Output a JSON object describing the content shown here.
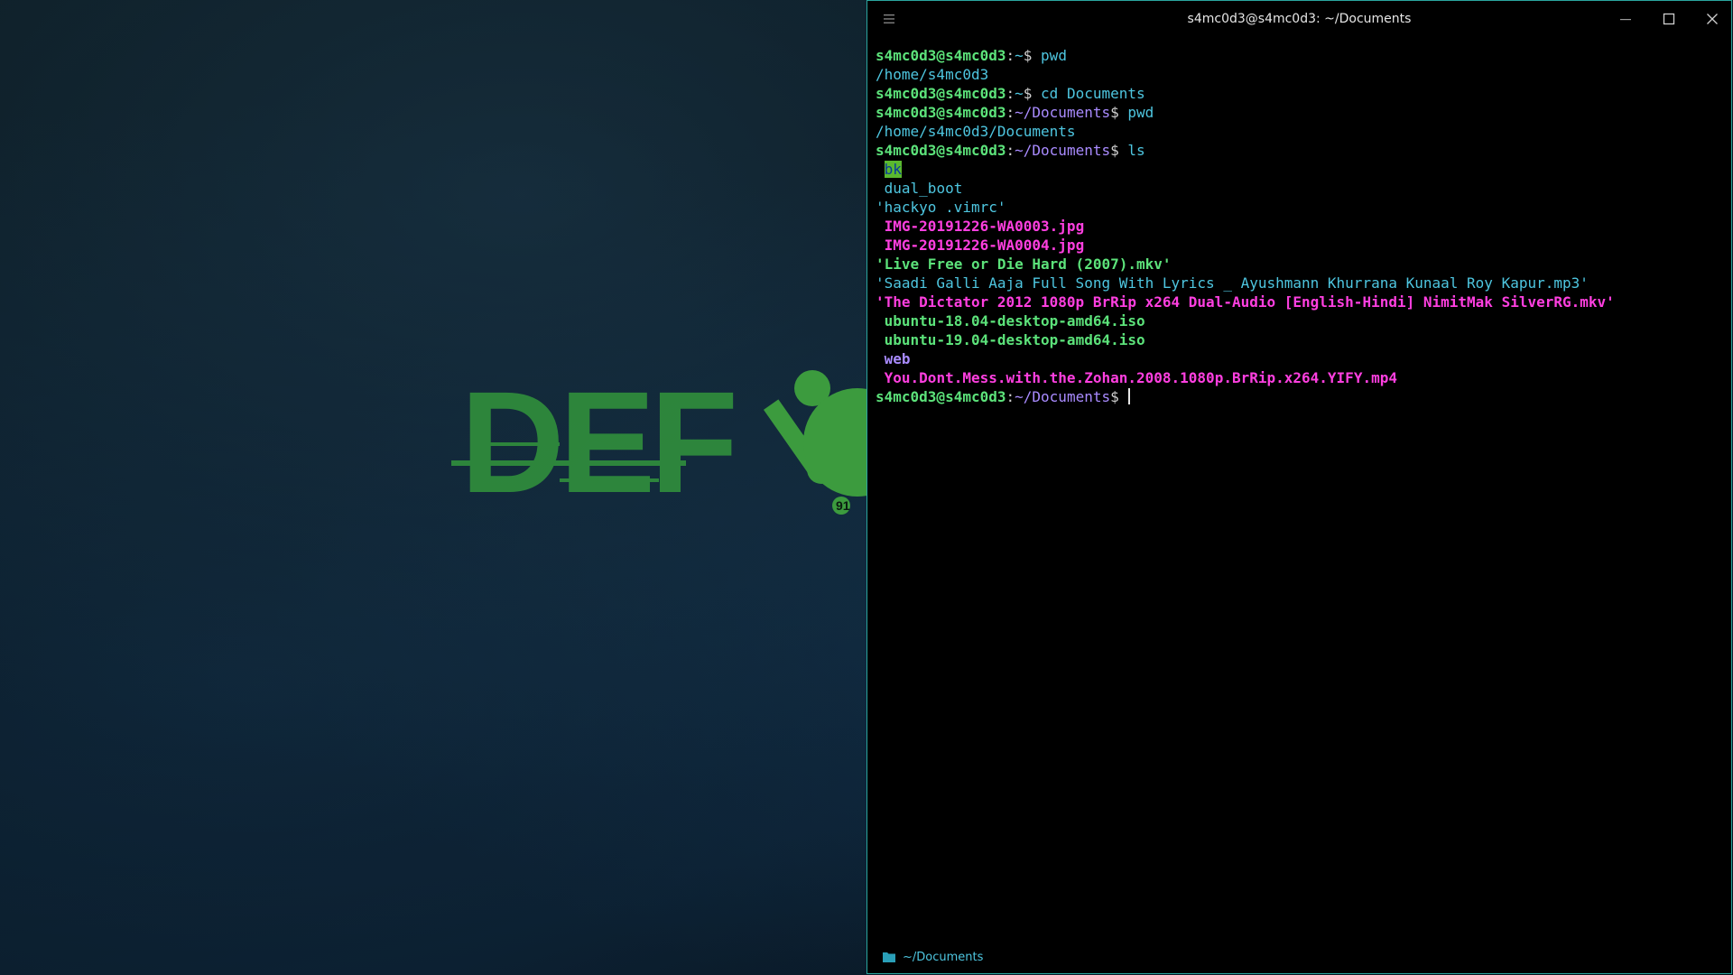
{
  "window": {
    "title": "s4mc0d3@s4mc0d3: ~/Documents"
  },
  "wallpaper": {
    "logo_text": "DEF",
    "badge_text": "91"
  },
  "terminal": {
    "lines": [
      {
        "type": "prompt",
        "user": "s4mc0d3@s4mc0d3",
        "colon": ":",
        "path": "~",
        "dollar": "$ ",
        "command": "pwd"
      },
      {
        "type": "output",
        "text": "/home/s4mc0d3",
        "class": "out"
      },
      {
        "type": "prompt",
        "user": "s4mc0d3@s4mc0d3",
        "colon": ":",
        "path": "~",
        "dollar": "$ ",
        "command": "cd Documents"
      },
      {
        "type": "prompt",
        "user": "s4mc0d3@s4mc0d3",
        "colon": ":",
        "path": "~/Documents",
        "dollar": "$ ",
        "command": "pwd"
      },
      {
        "type": "output",
        "text": "/home/s4mc0d3/Documents",
        "class": "out"
      },
      {
        "type": "prompt",
        "user": "s4mc0d3@s4mc0d3",
        "colon": ":",
        "path": "~/Documents",
        "dollar": "$ ",
        "command": "ls"
      },
      {
        "type": "file",
        "prefix": " ",
        "text": "bk",
        "class": "f-dir-hl"
      },
      {
        "type": "file",
        "prefix": " ",
        "text": "dual_boot",
        "class": "f-dir"
      },
      {
        "type": "file",
        "prefix": "",
        "text": "'hackyo .vimrc'",
        "class": "out"
      },
      {
        "type": "file",
        "prefix": " ",
        "text": "IMG-20191226-WA0003.jpg",
        "class": "f-img"
      },
      {
        "type": "file",
        "prefix": " ",
        "text": "IMG-20191226-WA0004.jpg",
        "class": "f-img"
      },
      {
        "type": "file",
        "prefix": "",
        "text": "'Live Free or Die Hard (2007).mkv'",
        "class": "f-media-g"
      },
      {
        "type": "file",
        "prefix": "",
        "text": "'Saadi Galli Aaja Full Song With Lyrics _ Ayushmann Khurrana Kunaal Roy Kapur.mp3'",
        "class": "f-audio"
      },
      {
        "type": "file",
        "prefix": "",
        "text": "'The Dictator 2012 1080p BrRip x264 Dual-Audio [English-Hindi] NimitMak SilverRG.mkv'",
        "class": "f-media-m"
      },
      {
        "type": "file",
        "prefix": " ",
        "text": "ubuntu-18.04-desktop-amd64.iso",
        "class": "f-media-g"
      },
      {
        "type": "file",
        "prefix": " ",
        "text": "ubuntu-19.04-desktop-amd64.iso",
        "class": "f-media-g"
      },
      {
        "type": "file",
        "prefix": " ",
        "text": "web",
        "class": "f-web"
      },
      {
        "type": "file",
        "prefix": " ",
        "text": "You.Dont.Mess.with.the.Zohan.2008.1080p.BrRip.x264.YIFY.mp4",
        "class": "f-media-m"
      },
      {
        "type": "prompt",
        "user": "s4mc0d3@s4mc0d3",
        "colon": ":",
        "path": "~/Documents",
        "dollar": "$ ",
        "command": "",
        "cursor": true
      }
    ]
  },
  "statusbar": {
    "icon": "folder-icon",
    "path": "~/Documents"
  },
  "colors": {
    "user": "#5ce27a",
    "path": "#a98bff",
    "text": "#4ec6e0",
    "image": "#ff3fe0",
    "border": "#2aa7a0"
  }
}
